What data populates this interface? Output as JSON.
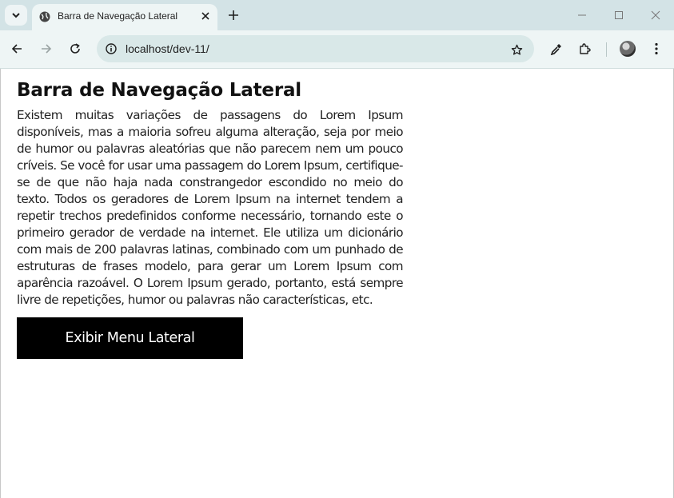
{
  "browser": {
    "tab_title": "Barra de Navegação Lateral",
    "url": "localhost/dev-11/",
    "icons": [
      "tab-search-icon",
      "globe-icon",
      "close-icon",
      "plus-icon",
      "minimize-icon",
      "maximize-icon",
      "window-close-icon",
      "back-icon",
      "forward-icon",
      "reload-icon",
      "site-info-icon",
      "star-icon",
      "eyedropper-icon",
      "extensions-icon",
      "avatar",
      "kebab-menu-icon"
    ]
  },
  "page": {
    "heading": "Barra de Navegação Lateral",
    "paragraph": "Existem muitas variações de passagens do Lorem Ipsum disponíveis, mas a maioria sofreu alguma alteração, seja por meio de humor ou palavras aleatórias que não parecem nem um pouco críveis. Se você for usar uma passagem do Lorem Ipsum, certifique-se de que não haja nada constrangedor escondido no meio do texto. Todos os geradores de Lorem Ipsum na internet tendem a repetir trechos predefinidos conforme necessário, tornando este o primeiro gerador de verdade na internet. Ele utiliza um dicionário com mais de 200 palavras latinas, combinado com um punhado de estruturas de frases modelo, para gerar um Lorem Ipsum com aparência razoável. O Lorem Ipsum gerado, portanto, está sempre livre de repetições, humor ou palavras não características, etc.",
    "button_label": "Exibir Menu Lateral"
  },
  "colors": {
    "tabstrip": "#d3e3e6",
    "toolbar": "#eef5f5",
    "button_bg": "#000000",
    "button_text": "#ffffff"
  }
}
